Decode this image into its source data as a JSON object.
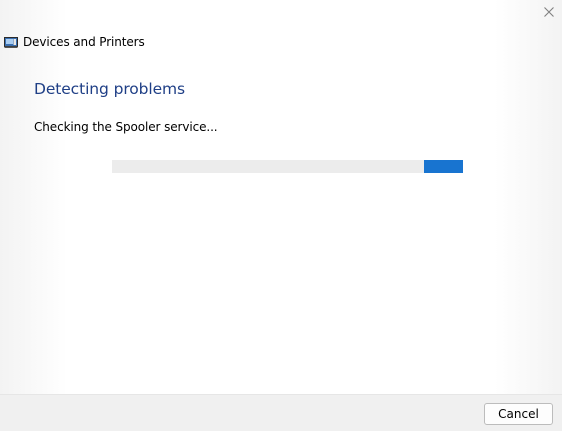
{
  "window": {
    "header_title": "Devices and Printers",
    "title": "Detecting problems",
    "status_text": "Checking the Spooler service...",
    "close_icon": "close-icon",
    "app_icon": "devices-printers-icon"
  },
  "progress": {
    "mode": "indeterminate",
    "indicator_position_fraction": 0.89,
    "indicator_width_fraction": 0.11,
    "accent_color": "#1874d0",
    "track_color": "#ececec"
  },
  "footer": {
    "cancel_label": "Cancel"
  },
  "colors": {
    "title": "#1f3f86",
    "accent": "#1874d0"
  }
}
